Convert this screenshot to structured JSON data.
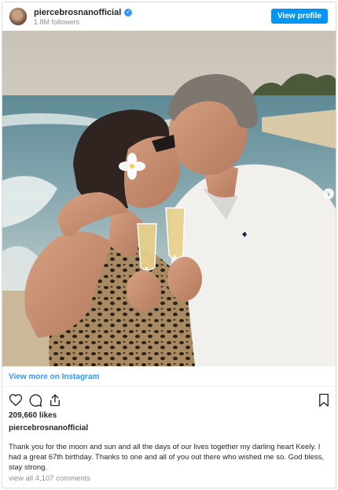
{
  "header": {
    "username": "piercebrosnanofficial",
    "followers": "1.8M followers",
    "view_profile_label": "View profile"
  },
  "post": {
    "image_alt": "Couple kissing on a beach holding champagne glasses",
    "view_more_label": "View more on Instagram",
    "likes": "209,660 likes",
    "caption_username": "piercebrosnanofficial",
    "caption": "Thank you for the moon and sun and all the days of our lives together my darling heart Keely. I had a great 67th birthday. Thanks to one and all of you out there who wished me so. God bless, stay strong.",
    "comments_link": "view all 4,107 comments"
  },
  "colors": {
    "accent": "#3897f0",
    "button": "#0095f6",
    "muted": "#8e8e8e"
  },
  "icons": [
    "heart-icon",
    "comment-icon",
    "share-icon",
    "bookmark-icon",
    "verified-icon",
    "next-arrow-icon"
  ]
}
